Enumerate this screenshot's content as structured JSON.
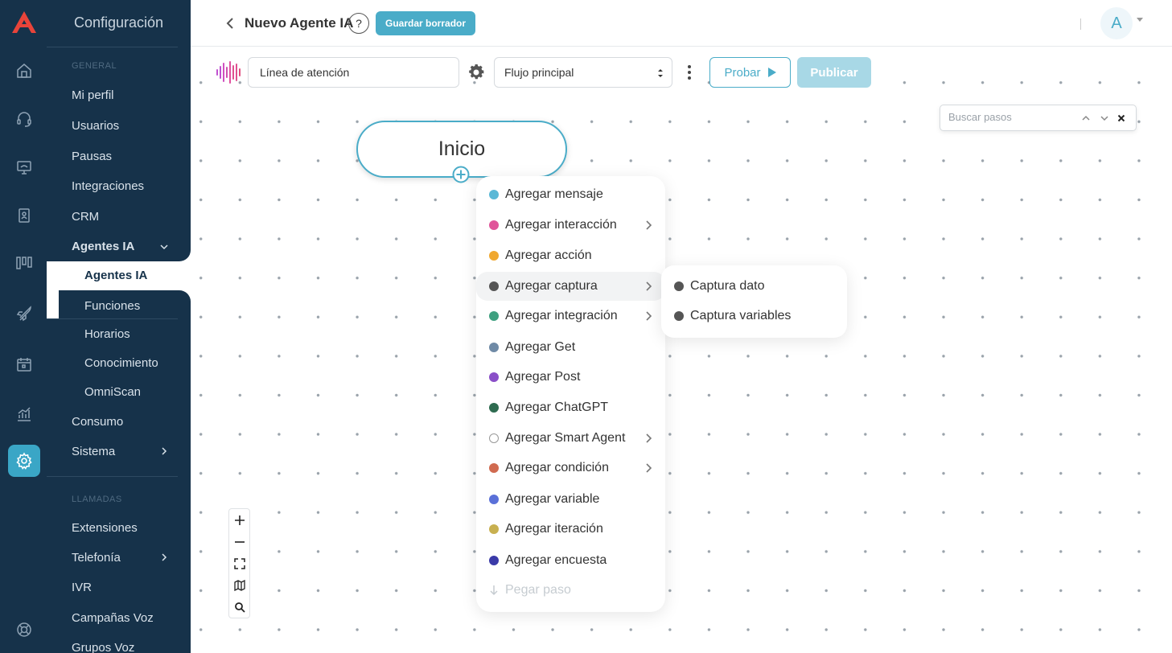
{
  "app": {
    "brand_color": "#3aa6c6",
    "sidebar_bg": "#16324a"
  },
  "sidebar": {
    "title": "Configuración",
    "section_general": "GENERAL",
    "section_calls": "LLAMADAS",
    "items": {
      "my_profile": "Mi perfil",
      "users": "Usuarios",
      "pauses": "Pausas",
      "integrations": "Integraciones",
      "crm": "CRM",
      "ai_agents_group": "Agentes IA",
      "ai_agents": "Agentes IA",
      "functions": "Funciones",
      "schedules": "Horarios",
      "knowledge": "Conocimiento",
      "omniscan": "OmniScan",
      "consumption": "Consumo",
      "system": "Sistema",
      "extensions": "Extensiones",
      "telephony": "Telefonía",
      "ivr": "IVR",
      "voice_campaigns": "Campañas Voz",
      "voice_groups": "Grupos Voz"
    }
  },
  "header": {
    "title": "Nuevo Agente IA",
    "help": "?",
    "save_draft": "Guardar borrador",
    "avatar_initial": "A"
  },
  "toolbar": {
    "line_name": "Línea de atención",
    "flow_selected": "Flujo principal",
    "test_label": "Probar",
    "publish_label": "Publicar"
  },
  "search": {
    "placeholder": "Buscar pasos"
  },
  "canvas": {
    "start_node": "Inicio"
  },
  "menu": {
    "items": [
      {
        "label": "Agregar mensaje",
        "color": "#5bb8d6",
        "submenu": false
      },
      {
        "label": "Agregar interacción",
        "color": "#e0559a",
        "submenu": true
      },
      {
        "label": "Agregar acción",
        "color": "#f0a830",
        "submenu": false
      },
      {
        "label": "Agregar captura",
        "color": "#555555",
        "submenu": true
      },
      {
        "label": "Agregar integración",
        "color": "#3fa080",
        "submenu": true
      },
      {
        "label": "Agregar Get",
        "color": "#6f8aa6",
        "submenu": false
      },
      {
        "label": "Agregar Post",
        "color": "#8a4fc8",
        "submenu": false
      },
      {
        "label": "Agregar ChatGPT",
        "color": "#2e6b50",
        "submenu": false
      },
      {
        "label": "Agregar Smart Agent",
        "color": "#ffffff",
        "submenu": true
      },
      {
        "label": "Agregar condición",
        "color": "#d06a50",
        "submenu": true
      },
      {
        "label": "Agregar variable",
        "color": "#5a70d8",
        "submenu": false
      },
      {
        "label": "Agregar iteración",
        "color": "#c8b050",
        "submenu": false
      },
      {
        "label": "Agregar encuesta",
        "color": "#3a3aa8",
        "submenu": false
      }
    ],
    "paste": "Pegar paso"
  },
  "submenu": {
    "items": [
      {
        "label": "Captura dato",
        "color": "#555555"
      },
      {
        "label": "Captura variables",
        "color": "#555555"
      }
    ]
  }
}
